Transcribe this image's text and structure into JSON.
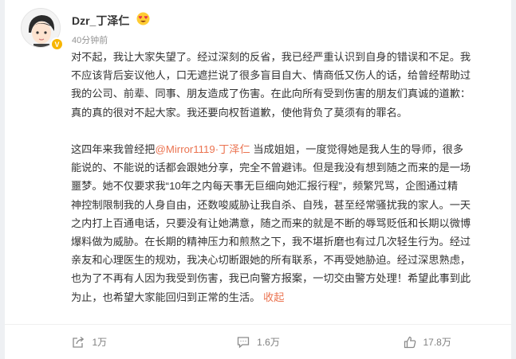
{
  "post": {
    "username": "Dzr_丁泽仁",
    "name_emoji": "heart-eyes-emoji",
    "verified_badge": "V",
    "timestamp": "40分钟前",
    "mention": "@Mirror1119·丁泽仁",
    "collapse_label": "收起",
    "lines": [
      "对不起，我让大家失望了。经过深刻的反省，我已经严重认识到自身的错误和不足。我",
      "不应该背后妄议他人，口无遮拦说了很多盲目自大、情商低又伤人的话，给曾经帮助过",
      "我的公司、前辈、同事、朋友造成了伤害。在此向所有受到伤害的朋友们真诚的道歉：",
      "真的真的很对不起大家。我还要向权哲道歉，使他背负了莫须有的罪名。"
    ],
    "para2_first_prefix": "这四年来我曾经把",
    "para2_first_suffix": " 当成姐姐，一度觉得她是我人生的导师，很多",
    "para2_lines": [
      "能说的、不能说的话都会跟她分享，完全不曾避讳。但是我没有想到随之而来的是一场",
      "噩梦。她不仅要求我“10年之内每天事无巨细向她汇报行程”，频繁咒骂，企图通过精",
      "神控制限制我的人身自由，还数唆威胁让我自杀、自残，甚至经常骚扰我的家人。一天",
      "之内打上百通电话，只要没有让她满意，随之而来的就是不断的辱骂贬低和长期以微博",
      "爆料做为威胁。在长期的精神压力和煎熬之下，我不堪折磨也有过几次轻生行为。经过",
      "亲友和心理医生的规劝，我决心切断跟她的所有联系，不再受她胁迫。经过深思熟虑，",
      "也为了不再有人因为我受到伤害，我已向警方报案，一切交由警方处理！希望此事到此"
    ],
    "para2_last": "为止，也希望大家能回归到正常的生活。 "
  },
  "actions": {
    "share": {
      "icon": "share-icon",
      "count": "1万"
    },
    "comment": {
      "icon": "comment-icon",
      "count": "1.6万"
    },
    "like": {
      "icon": "thumbs-up-icon",
      "count": "17.8万"
    }
  },
  "colors": {
    "link": "#eb7350",
    "text": "#333333",
    "meta": "#939393",
    "badge": "#f7b500"
  }
}
